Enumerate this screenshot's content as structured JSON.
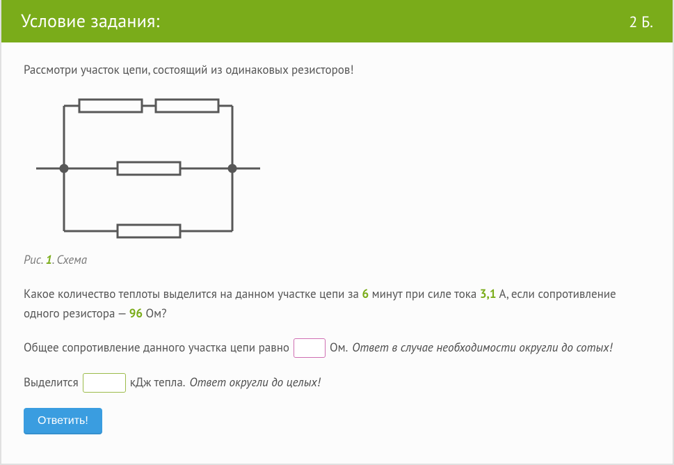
{
  "header": {
    "title": "Условие задания:",
    "points": "2 Б."
  },
  "content": {
    "intro": "Рассмотри участок цепи, состоящий из одинаковых резисторов!",
    "caption_prefix": "Рис. ",
    "caption_num": "1",
    "caption_suffix": ". Схема",
    "q1_a": "Какое количество теплоты выделится на данном участке цепи за ",
    "q1_minutes": "6",
    "q1_b": " минут при силе тока ",
    "q1_current": "3,1",
    "q1_c": " А, если сопротивление одного резистора — ",
    "q1_res": "96",
    "q1_d": " Ом?",
    "q2_before": "Общее сопротивление данного участка цепи равно",
    "q2_after": "Ом.",
    "q2_hint": "Ответ в случае необходимости округли до сотых!",
    "q3_before": "Выделится",
    "q3_after": "кДж тепла.",
    "q3_hint": "Ответ округли до целых!",
    "submit": "Ответить!"
  },
  "inputs": {
    "resistance_value": "",
    "heat_value": ""
  }
}
